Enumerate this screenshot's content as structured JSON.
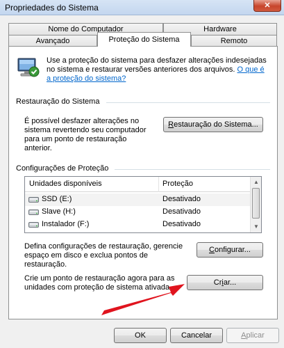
{
  "window": {
    "title": "Propriedades do Sistema",
    "close_label": "✕"
  },
  "tabs": {
    "top_row": [
      "Nome do Computador",
      "Hardware"
    ],
    "bottom_row": [
      "Avançado",
      "Proteção do Sistema",
      "Remoto"
    ],
    "active": "Proteção do Sistema"
  },
  "intro": {
    "text": "Use a proteção do sistema para desfazer alterações indesejadas no sistema e restaurar versões anteriores dos arquivos.",
    "link": "O que é a proteção do sistema?"
  },
  "restore": {
    "heading": "Restauração do Sistema",
    "description": "É possível desfazer alterações no sistema revertendo seu computador para um ponto de restauração anterior.",
    "button_prefix": "R",
    "button_rest": "estauração do Sistema..."
  },
  "protection": {
    "heading": "Configurações de Proteção",
    "columns": [
      "Unidades disponíveis",
      "Proteção"
    ],
    "rows": [
      {
        "name": "SSD (E:)",
        "status": "Desativado",
        "icon": "drive-icon"
      },
      {
        "name": "Slave (H:)",
        "status": "Desativado",
        "icon": "drive-icon"
      },
      {
        "name": "Instalador (F:)",
        "status": "Desativado",
        "icon": "drive-icon"
      }
    ]
  },
  "configure": {
    "description": "Defina configurações de restauração, gerencie espaço em disco e exclua pontos de restauração.",
    "button_prefix": "C",
    "button_rest": "onfigurar..."
  },
  "create": {
    "description": "Crie um ponto de restauração agora para as unidades com proteção de sistema ativada.",
    "button_before": "Cr",
    "button_underlined": "i",
    "button_after": "ar..."
  },
  "footer": {
    "ok": "OK",
    "cancel": "Cancelar",
    "apply_prefix": "A",
    "apply_rest": "plicar"
  },
  "colors": {
    "link": "#0066cc",
    "annotation_arrow": "#e0141e"
  }
}
